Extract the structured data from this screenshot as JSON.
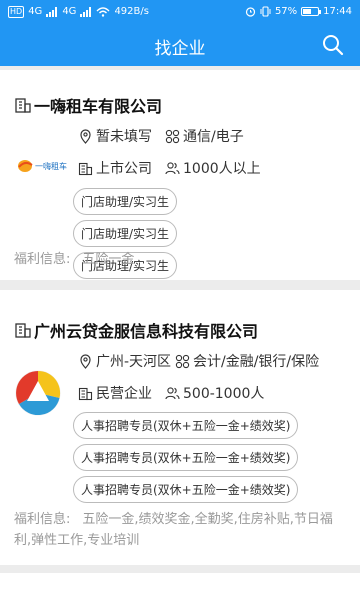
{
  "status_bar": {
    "left": {
      "hd": "HD",
      "net1": "4G",
      "net2": "4G",
      "speed": "492B/s"
    },
    "right": {
      "battery_text": "57%",
      "time": "17:44",
      "battery_level": 0.57
    }
  },
  "navbar": {
    "title": "找企业",
    "search_icon": "search-icon"
  },
  "companies": [
    {
      "name": "一嗨租车有限公司",
      "logo_text": "一嗨租车",
      "location": "暂未填写",
      "industry": "通信/电子",
      "type": "上市公司",
      "size": "1000人以上",
      "jobs": [
        "门店助理/实习生",
        "门店助理/实习生",
        "门店助理/实习生"
      ],
      "welfare_label": "福利信息:",
      "welfare": "五险一金"
    },
    {
      "name": "广州云贷金服信息科技有限公司",
      "location": "广州-天河区",
      "industry": "会计/金融/银行/保险",
      "type": "民营企业",
      "size": "500-1000人",
      "jobs": [
        "人事招聘专员(双休+五险一金+绩效奖)",
        "人事招聘专员(双休+五险一金+绩效奖)",
        "人事招聘专员(双休+五险一金+绩效奖)"
      ],
      "welfare_label": "福利信息:",
      "welfare": "五险一金,绩效奖金,全勤奖,住房补贴,节日福利,弹性工作,专业培训"
    }
  ],
  "colors": {
    "primary": "#2196f3",
    "background": "#ececec",
    "muted": "#999999"
  }
}
